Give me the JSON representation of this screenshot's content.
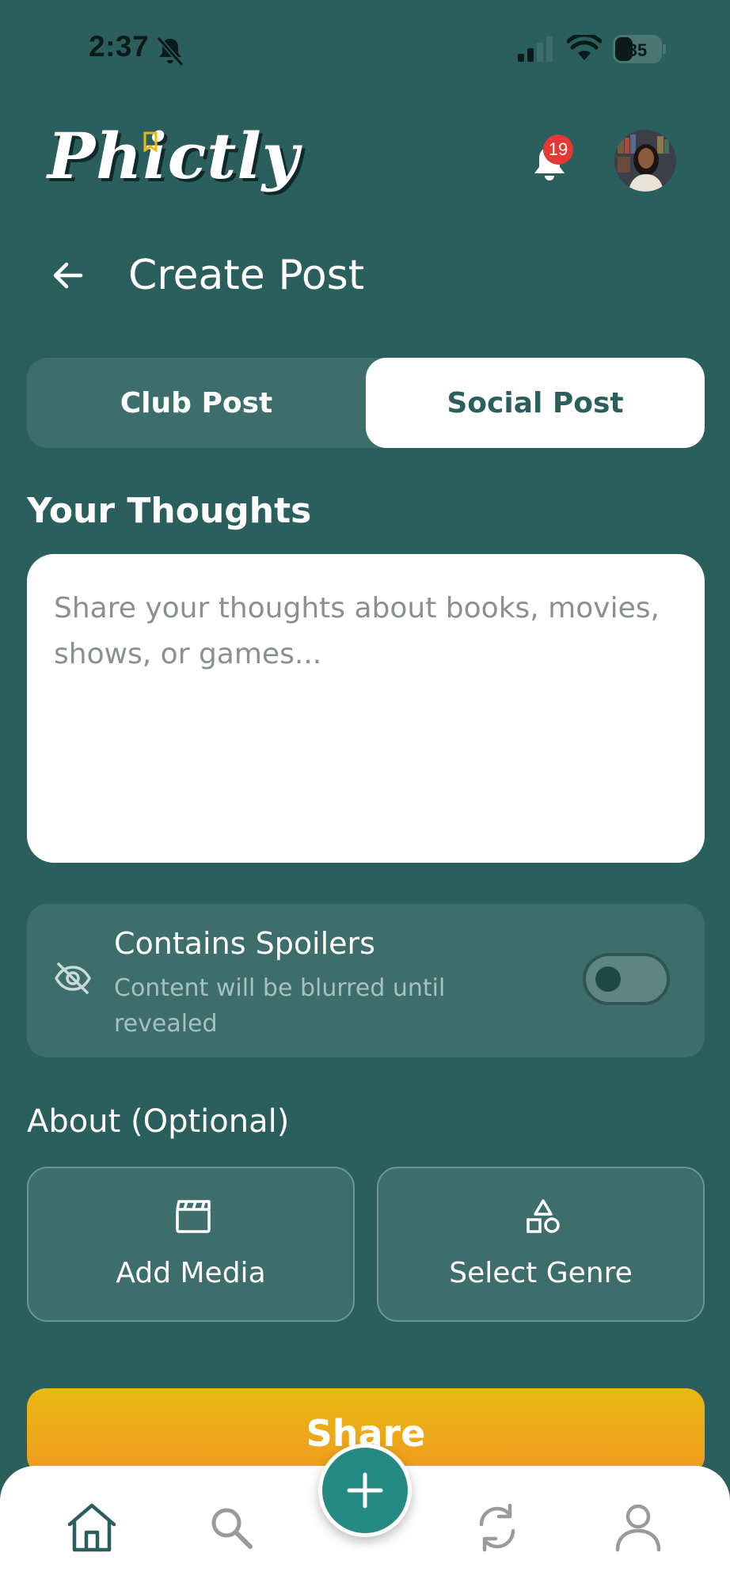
{
  "status_bar": {
    "time": "2:37",
    "battery": "35",
    "icons": [
      "bell-slash-icon",
      "cellular-signal-icon",
      "wifi-icon",
      "battery-icon"
    ]
  },
  "header": {
    "logo": "Phictly",
    "notification_count": "19",
    "icons": [
      "bell-icon",
      "avatar"
    ]
  },
  "page": {
    "title": "Create Post",
    "back_icon": "arrow-left-icon"
  },
  "post_type": {
    "tabs": [
      {
        "label": "Club Post",
        "selected": false
      },
      {
        "label": "Social Post",
        "selected": true
      }
    ]
  },
  "thoughts": {
    "label": "Your Thoughts",
    "placeholder": "Share your thoughts about books, movies, shows, or games...",
    "value": ""
  },
  "spoiler": {
    "title": "Contains Spoilers",
    "subtitle": "Content will be blurred until revealed",
    "enabled": false,
    "icon": "eye-off-icon"
  },
  "about": {
    "label": "About (Optional)",
    "options": [
      {
        "label": "Add Media",
        "icon": "clapperboard-icon"
      },
      {
        "label": "Select Genre",
        "icon": "shapes-icon"
      }
    ]
  },
  "share_label": "Share",
  "tabbar": {
    "items": [
      "home-icon",
      "search-icon",
      "plus-icon",
      "refresh-icon",
      "profile-icon"
    ]
  },
  "colors": {
    "background": "#2b5f5d",
    "panel": "#3d6e6b",
    "accent_gradient_top": "#e9b912",
    "accent_gradient_bottom": "#f09a1f",
    "fab": "#258a83",
    "badge": "#e53935"
  }
}
